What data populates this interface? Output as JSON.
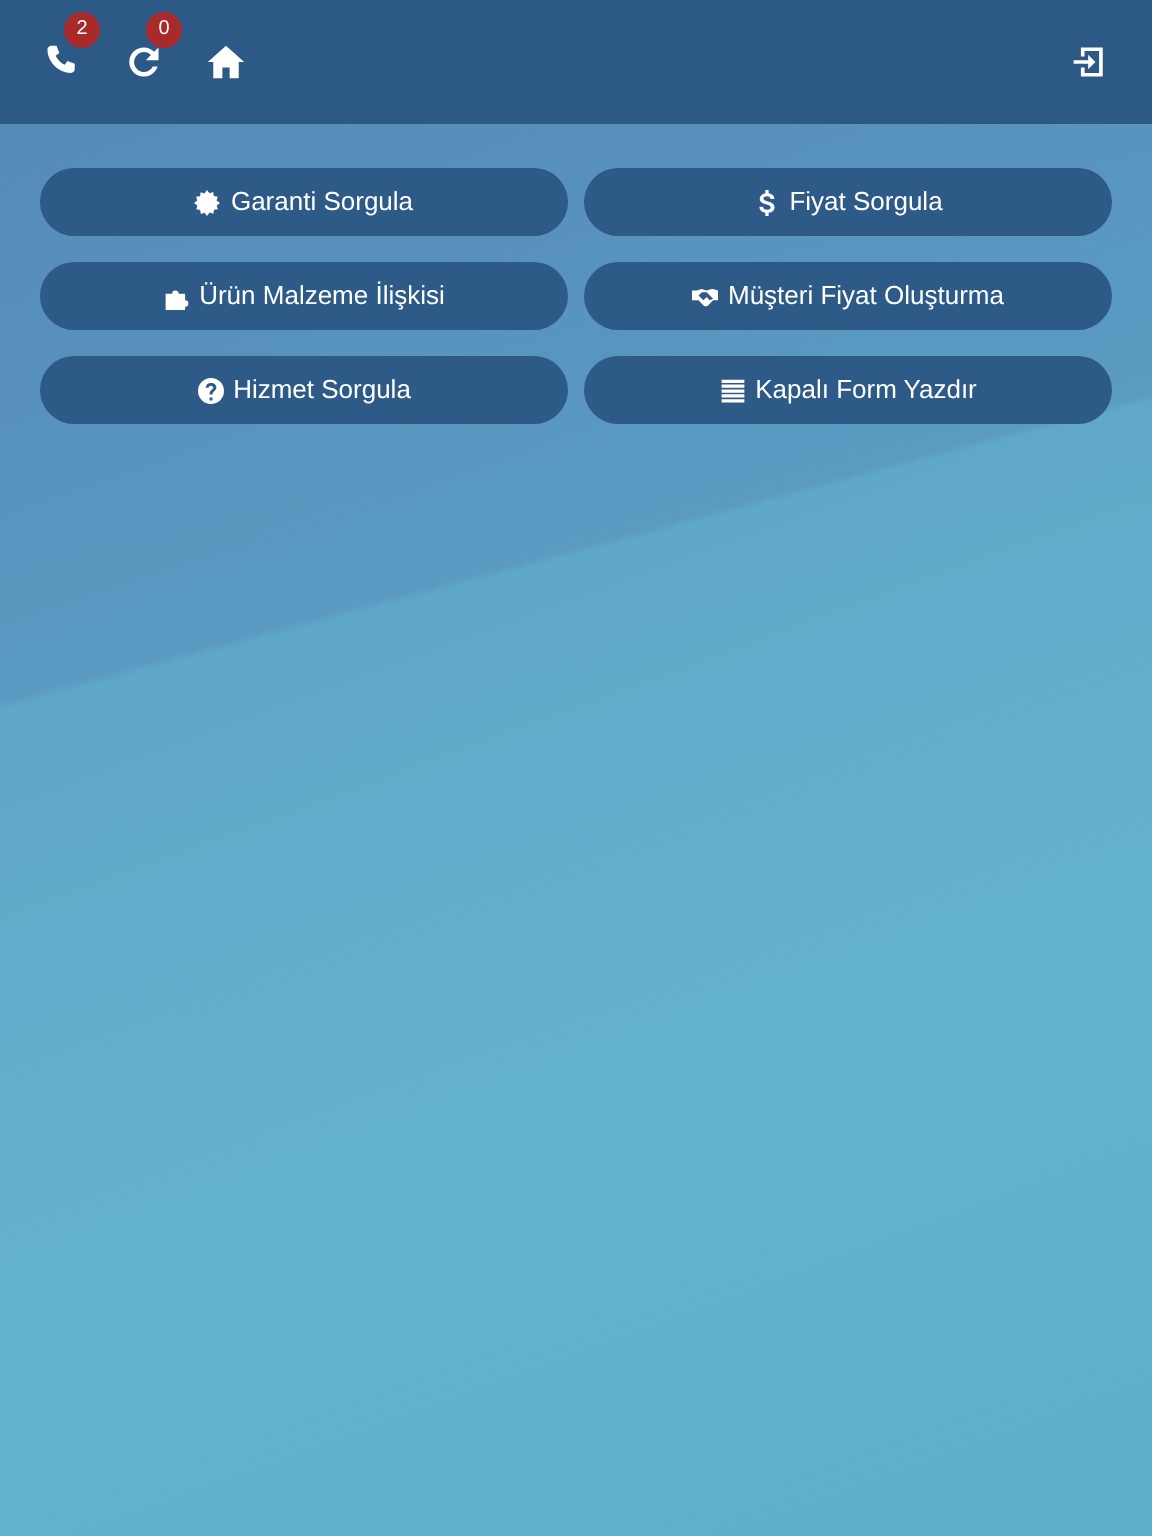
{
  "toolbar": {
    "left_icons": [
      {
        "kind": "phone",
        "badge": "2"
      },
      {
        "kind": "refresh",
        "badge": "0"
      },
      {
        "kind": "home"
      }
    ],
    "right_icons": [
      {
        "kind": "login"
      }
    ]
  },
  "buttons": [
    {
      "label": "Garanti Sorgula",
      "kind": "badge"
    },
    {
      "label": "Fiyat Sorgula",
      "kind": "dollar"
    },
    {
      "label": "Ürün Malzeme İlişkisi",
      "kind": "puzzle"
    },
    {
      "label": "Müşteri Fiyat Oluşturma",
      "kind": "handshake"
    },
    {
      "label": "Hizmet Sorgula",
      "kind": "question"
    },
    {
      "label": "Kapalı Form Yazdır",
      "kind": "lines"
    }
  ]
}
